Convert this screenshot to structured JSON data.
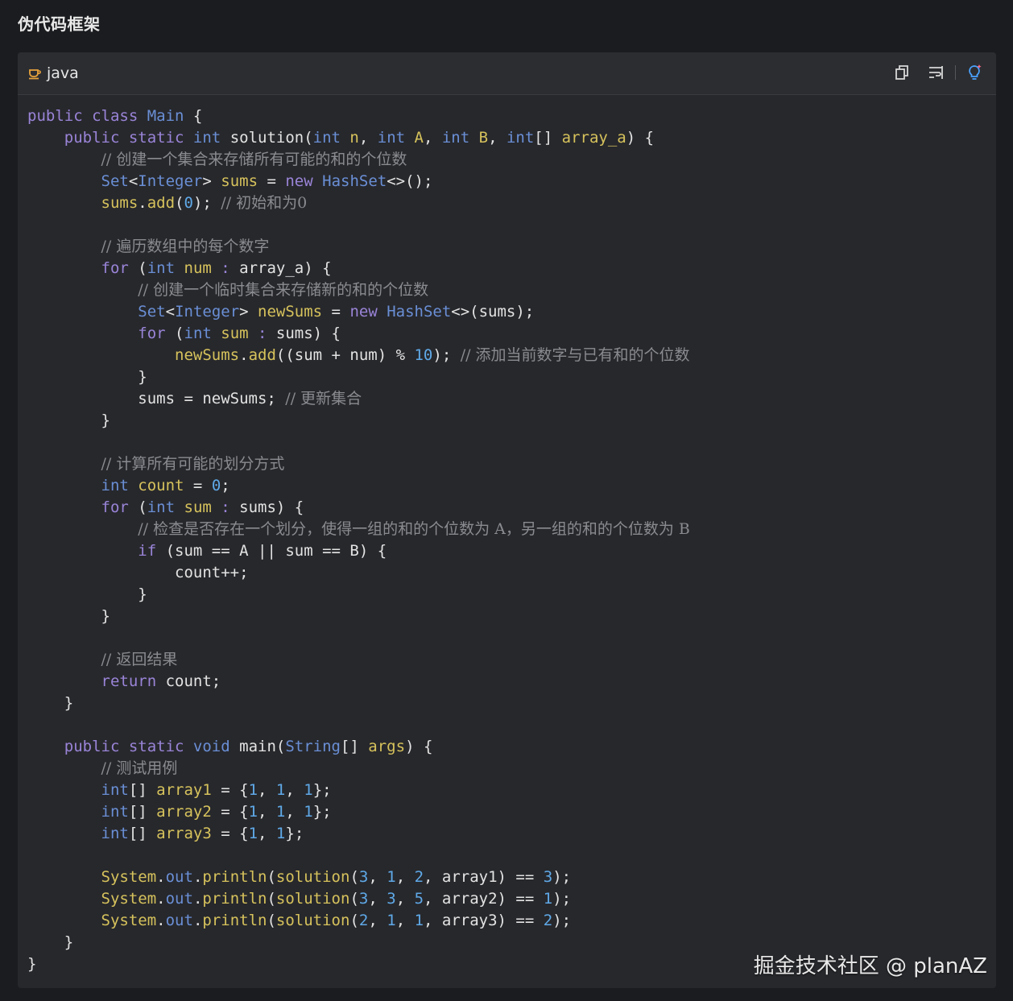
{
  "page_title": "伪代码框架",
  "code_block": {
    "language": "java",
    "language_icon": "cup-icon",
    "actions": [
      {
        "name": "copy-button",
        "icon": "copy-icon"
      },
      {
        "name": "wrap-button",
        "icon": "wrap-lines-icon"
      },
      {
        "name": "ai-explain-button",
        "icon": "lightbulb-icon"
      }
    ],
    "lines": [
      [
        [
          "k",
          "public class "
        ],
        [
          "c",
          "Main "
        ],
        [
          "p",
          "{"
        ]
      ],
      [
        [
          "p",
          "    "
        ],
        [
          "k",
          "public static "
        ],
        [
          "c",
          "int "
        ],
        [
          "p",
          "solution("
        ],
        [
          "c",
          "int "
        ],
        [
          "y",
          "n"
        ],
        [
          "p",
          ", "
        ],
        [
          "c",
          "int "
        ],
        [
          "y",
          "A"
        ],
        [
          "p",
          ", "
        ],
        [
          "c",
          "int "
        ],
        [
          "y",
          "B"
        ],
        [
          "p",
          ", "
        ],
        [
          "c",
          "int"
        ],
        [
          "p",
          "[] "
        ],
        [
          "y",
          "array_a"
        ],
        [
          "p",
          ") {"
        ]
      ],
      [
        [
          "p",
          "        "
        ],
        [
          "cm",
          "// 创建一个集合来存储所有可能的和的个位数"
        ]
      ],
      [
        [
          "p",
          "        "
        ],
        [
          "c",
          "Set"
        ],
        [
          "p",
          "<"
        ],
        [
          "c",
          "Integer"
        ],
        [
          "p",
          "> "
        ],
        [
          "y",
          "sums "
        ],
        [
          "p",
          "= "
        ],
        [
          "k",
          "new "
        ],
        [
          "c",
          "HashSet"
        ],
        [
          "p",
          "<>();"
        ]
      ],
      [
        [
          "p",
          "        "
        ],
        [
          "y",
          "sums"
        ],
        [
          "p",
          "."
        ],
        [
          "y",
          "add"
        ],
        [
          "p",
          "("
        ],
        [
          "n",
          "0"
        ],
        [
          "p",
          "); "
        ],
        [
          "cm",
          "// 初始和为0"
        ]
      ],
      [
        [
          "p",
          ""
        ]
      ],
      [
        [
          "p",
          "        "
        ],
        [
          "cm",
          "// 遍历数组中的每个数字"
        ]
      ],
      [
        [
          "p",
          "        "
        ],
        [
          "k",
          "for "
        ],
        [
          "p",
          "("
        ],
        [
          "c",
          "int "
        ],
        [
          "y",
          "num "
        ],
        [
          "k",
          ": "
        ],
        [
          "p",
          "array_a) {"
        ]
      ],
      [
        [
          "p",
          "            "
        ],
        [
          "cm",
          "// 创建一个临时集合来存储新的和的个位数"
        ]
      ],
      [
        [
          "p",
          "            "
        ],
        [
          "c",
          "Set"
        ],
        [
          "p",
          "<"
        ],
        [
          "c",
          "Integer"
        ],
        [
          "p",
          "> "
        ],
        [
          "y",
          "newSums "
        ],
        [
          "p",
          "= "
        ],
        [
          "k",
          "new "
        ],
        [
          "c",
          "HashSet"
        ],
        [
          "p",
          "<>(sums);"
        ]
      ],
      [
        [
          "p",
          "            "
        ],
        [
          "k",
          "for "
        ],
        [
          "p",
          "("
        ],
        [
          "c",
          "int "
        ],
        [
          "y",
          "sum "
        ],
        [
          "k",
          ": "
        ],
        [
          "p",
          "sums) {"
        ]
      ],
      [
        [
          "p",
          "                "
        ],
        [
          "y",
          "newSums"
        ],
        [
          "p",
          "."
        ],
        [
          "y",
          "add"
        ],
        [
          "p",
          "((sum + num) % "
        ],
        [
          "n",
          "10"
        ],
        [
          "p",
          "); "
        ],
        [
          "cm",
          "// 添加当前数字与已有和的个位数"
        ]
      ],
      [
        [
          "p",
          "            }"
        ]
      ],
      [
        [
          "p",
          "            sums = newSums; "
        ],
        [
          "cm",
          "// 更新集合"
        ]
      ],
      [
        [
          "p",
          "        }"
        ]
      ],
      [
        [
          "p",
          ""
        ]
      ],
      [
        [
          "p",
          "        "
        ],
        [
          "cm",
          "// 计算所有可能的划分方式"
        ]
      ],
      [
        [
          "p",
          "        "
        ],
        [
          "c",
          "int "
        ],
        [
          "y",
          "count "
        ],
        [
          "p",
          "= "
        ],
        [
          "n",
          "0"
        ],
        [
          "p",
          ";"
        ]
      ],
      [
        [
          "p",
          "        "
        ],
        [
          "k",
          "for "
        ],
        [
          "p",
          "("
        ],
        [
          "c",
          "int "
        ],
        [
          "y",
          "sum "
        ],
        [
          "k",
          ": "
        ],
        [
          "p",
          "sums) {"
        ]
      ],
      [
        [
          "p",
          "            "
        ],
        [
          "cm",
          "// 检查是否存在一个划分，使得一组的和的个位数为 A，另一组的和的个位数为 B"
        ]
      ],
      [
        [
          "p",
          "            "
        ],
        [
          "k",
          "if "
        ],
        [
          "p",
          "(sum == A || sum == B) {"
        ]
      ],
      [
        [
          "p",
          "                count++;"
        ]
      ],
      [
        [
          "p",
          "            }"
        ]
      ],
      [
        [
          "p",
          "        }"
        ]
      ],
      [
        [
          "p",
          ""
        ]
      ],
      [
        [
          "p",
          "        "
        ],
        [
          "cm",
          "// 返回结果"
        ]
      ],
      [
        [
          "p",
          "        "
        ],
        [
          "k",
          "return "
        ],
        [
          "p",
          "count;"
        ]
      ],
      [
        [
          "p",
          "    }"
        ]
      ],
      [
        [
          "p",
          ""
        ]
      ],
      [
        [
          "p",
          "    "
        ],
        [
          "k",
          "public static "
        ],
        [
          "c",
          "void "
        ],
        [
          "p",
          "main("
        ],
        [
          "c",
          "String"
        ],
        [
          "p",
          "[] "
        ],
        [
          "y",
          "args"
        ],
        [
          "p",
          ") {"
        ]
      ],
      [
        [
          "p",
          "        "
        ],
        [
          "cm",
          "// 测试用例"
        ]
      ],
      [
        [
          "p",
          "        "
        ],
        [
          "c",
          "int"
        ],
        [
          "p",
          "[] "
        ],
        [
          "y",
          "array1 "
        ],
        [
          "p",
          "= {"
        ],
        [
          "n",
          "1"
        ],
        [
          "p",
          ", "
        ],
        [
          "n",
          "1"
        ],
        [
          "p",
          ", "
        ],
        [
          "n",
          "1"
        ],
        [
          "p",
          "};"
        ]
      ],
      [
        [
          "p",
          "        "
        ],
        [
          "c",
          "int"
        ],
        [
          "p",
          "[] "
        ],
        [
          "y",
          "array2 "
        ],
        [
          "p",
          "= {"
        ],
        [
          "n",
          "1"
        ],
        [
          "p",
          ", "
        ],
        [
          "n",
          "1"
        ],
        [
          "p",
          ", "
        ],
        [
          "n",
          "1"
        ],
        [
          "p",
          "};"
        ]
      ],
      [
        [
          "p",
          "        "
        ],
        [
          "c",
          "int"
        ],
        [
          "p",
          "[] "
        ],
        [
          "y",
          "array3 "
        ],
        [
          "p",
          "= {"
        ],
        [
          "n",
          "1"
        ],
        [
          "p",
          ", "
        ],
        [
          "n",
          "1"
        ],
        [
          "p",
          "};"
        ]
      ],
      [
        [
          "p",
          ""
        ]
      ],
      [
        [
          "p",
          "        "
        ],
        [
          "y",
          "System"
        ],
        [
          "p",
          "."
        ],
        [
          "c",
          "out"
        ],
        [
          "p",
          "."
        ],
        [
          "y",
          "println"
        ],
        [
          "p",
          "("
        ],
        [
          "y",
          "solution"
        ],
        [
          "p",
          "("
        ],
        [
          "n",
          "3"
        ],
        [
          "p",
          ", "
        ],
        [
          "n",
          "1"
        ],
        [
          "p",
          ", "
        ],
        [
          "n",
          "2"
        ],
        [
          "p",
          ", array1) == "
        ],
        [
          "n",
          "3"
        ],
        [
          "p",
          ");"
        ]
      ],
      [
        [
          "p",
          "        "
        ],
        [
          "y",
          "System"
        ],
        [
          "p",
          "."
        ],
        [
          "c",
          "out"
        ],
        [
          "p",
          "."
        ],
        [
          "y",
          "println"
        ],
        [
          "p",
          "("
        ],
        [
          "y",
          "solution"
        ],
        [
          "p",
          "("
        ],
        [
          "n",
          "3"
        ],
        [
          "p",
          ", "
        ],
        [
          "n",
          "3"
        ],
        [
          "p",
          ", "
        ],
        [
          "n",
          "5"
        ],
        [
          "p",
          ", array2) == "
        ],
        [
          "n",
          "1"
        ],
        [
          "p",
          ");"
        ]
      ],
      [
        [
          "p",
          "        "
        ],
        [
          "y",
          "System"
        ],
        [
          "p",
          "."
        ],
        [
          "c",
          "out"
        ],
        [
          "p",
          "."
        ],
        [
          "y",
          "println"
        ],
        [
          "p",
          "("
        ],
        [
          "y",
          "solution"
        ],
        [
          "p",
          "("
        ],
        [
          "n",
          "2"
        ],
        [
          "p",
          ", "
        ],
        [
          "n",
          "1"
        ],
        [
          "p",
          ", "
        ],
        [
          "n",
          "1"
        ],
        [
          "p",
          ", array3) == "
        ],
        [
          "n",
          "2"
        ],
        [
          "p",
          ");"
        ]
      ],
      [
        [
          "p",
          "    }"
        ]
      ],
      [
        [
          "p",
          "}"
        ]
      ]
    ]
  },
  "watermark": "掘金技术社区 @ planAZ",
  "colors": {
    "background": "#1b1c1f",
    "code_bg": "#27282c",
    "keyword": "#9a84d8",
    "type": "#6a8fd6",
    "identifier": "#d6c25c",
    "number": "#5fa9e8",
    "comment": "#8a8b90",
    "lightbulb_accent": "#4aa3ff"
  }
}
